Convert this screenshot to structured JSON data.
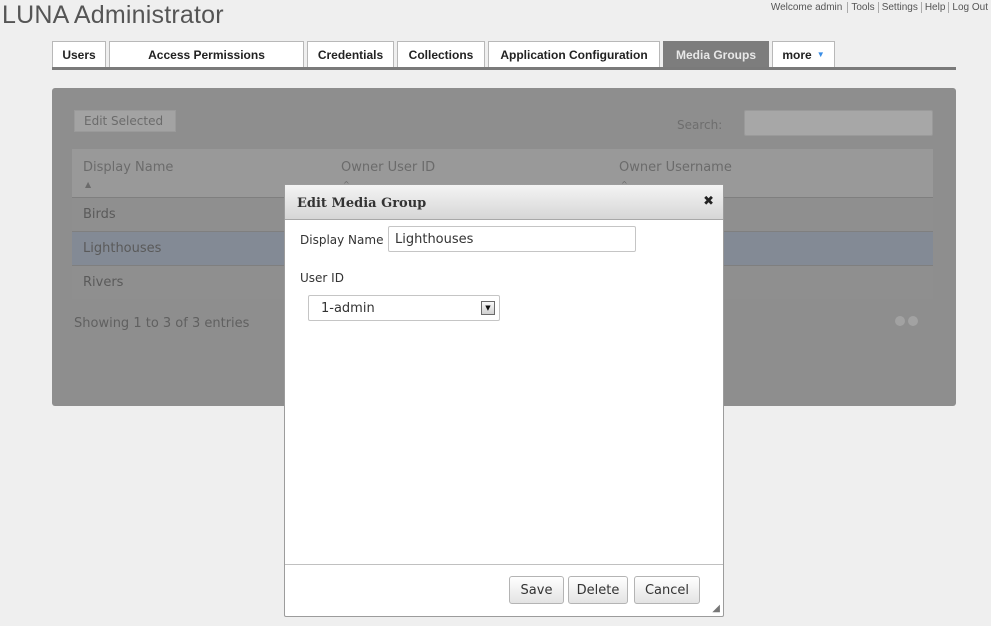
{
  "app": {
    "title": "LUNA Administrator"
  },
  "top_links": {
    "welcome": "Welcome admin",
    "items": [
      "Tools",
      "Settings",
      "Help",
      "Log Out"
    ]
  },
  "tabs": [
    {
      "label": "Users"
    },
    {
      "label": "Access Permissions"
    },
    {
      "label": "Credentials"
    },
    {
      "label": "Collections"
    },
    {
      "label": "Application Configuration"
    },
    {
      "label": "Media Groups",
      "active": true
    },
    {
      "label": "more"
    }
  ],
  "panel": {
    "edit_selected": "Edit Selected",
    "search_label": "Search:",
    "search_value": "",
    "columns": [
      "Display Name",
      "Owner User ID",
      "Owner Username"
    ],
    "rows": [
      {
        "display_name": "Birds"
      },
      {
        "display_name": "Lighthouses",
        "selected": true
      },
      {
        "display_name": "Rivers"
      }
    ],
    "info": "Showing 1 to 3 of 3 entries"
  },
  "modal": {
    "title": "Edit Media Group",
    "close_icon": "close-icon",
    "display_name_label": "Display Name",
    "display_name_value": "Lighthouses",
    "user_id_label": "User ID",
    "user_id_selected": "1-admin",
    "buttons": {
      "save": "Save",
      "delete": "Delete",
      "cancel": "Cancel"
    }
  },
  "colors": {
    "active_tab": "#7d7d7d",
    "accent": "#3a8ee6",
    "selected_row": "#838a95"
  }
}
